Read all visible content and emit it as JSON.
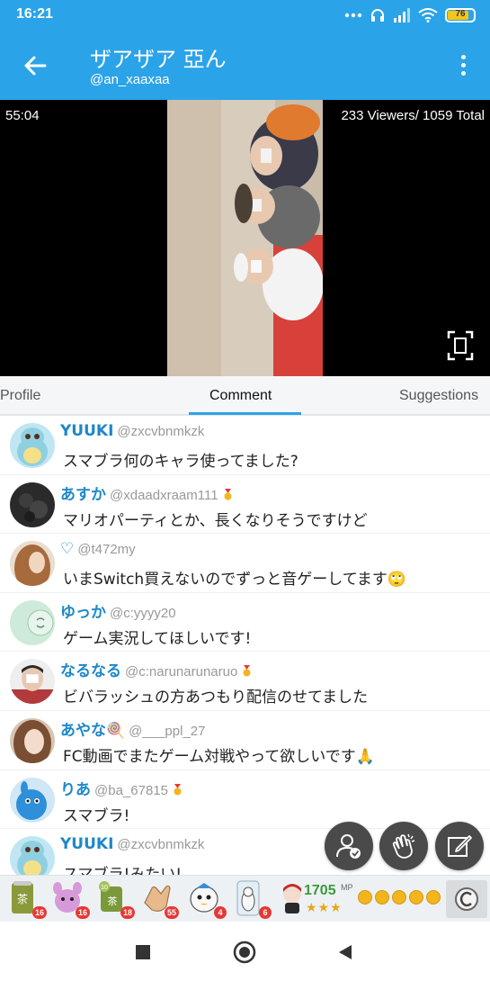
{
  "status_bar": {
    "time": "16:21",
    "battery_level": "76",
    "icons": [
      "more-dots-icon",
      "headset-icon",
      "signal-icon",
      "wifi-icon",
      "battery-icon"
    ]
  },
  "header": {
    "title": "ザアザア 亞ん",
    "subtitle": "@an_xaaxaa"
  },
  "video": {
    "elapsed": "55:04",
    "viewers": "233 Viewers/ 1059 Total"
  },
  "tabs": [
    {
      "label": "Profile",
      "active": false
    },
    {
      "label": "Comment",
      "active": true
    },
    {
      "label": "Suggestions",
      "active": false
    }
  ],
  "comments": [
    {
      "name": "YUUKI",
      "handle": "@zxcvbnmkzk",
      "text": "スマブラ何のキャラ使ってました?",
      "badge": false
    },
    {
      "name": "あすか",
      "handle": "@xdaadxraam111",
      "text": "マリオパーティとか、長くなりそうですけど",
      "badge": true
    },
    {
      "name": "♡",
      "handle": "@t472my",
      "text": "いまSwitch買えないのでずっと音ゲーしてます🙄",
      "badge": false
    },
    {
      "name": "ゆっか",
      "handle": "@c:yyyy20",
      "text": "ゲーム実況してほしいです!",
      "badge": false
    },
    {
      "name": "なるなる",
      "handle": "@c:narunarunaruo",
      "text": "ビバラッシュの方あつもり配信のせてました",
      "badge": true
    },
    {
      "name": "あやな🍭",
      "handle": "@___ppl_27",
      "text": "FC動画でまたゲーム対戦やって欲しいです🙏",
      "badge": false
    },
    {
      "name": "りあ",
      "handle": "@ba_67815",
      "text": "スマブラ!",
      "badge": true
    },
    {
      "name": "YUUKI",
      "handle": "@zxcvbnmkzk",
      "text": "スマブラ!みたい!",
      "badge": false
    }
  ],
  "gifts": [
    {
      "icon": "tea-can-icon",
      "count": "16"
    },
    {
      "icon": "pink-creature-icon",
      "count": "16"
    },
    {
      "icon": "tea-cup-icon",
      "count": "18"
    },
    {
      "icon": "clap-hands-icon",
      "count": "55"
    },
    {
      "icon": "ghost-icon",
      "count": "4"
    },
    {
      "icon": "figure-icon",
      "count": "6"
    }
  ],
  "mp": {
    "value": "1705",
    "unit": "MP",
    "stars": "★★★"
  },
  "colors": {
    "accent": "#2ba3e8",
    "name_color": "#1e88c7",
    "fab": "#4a4a4a"
  }
}
